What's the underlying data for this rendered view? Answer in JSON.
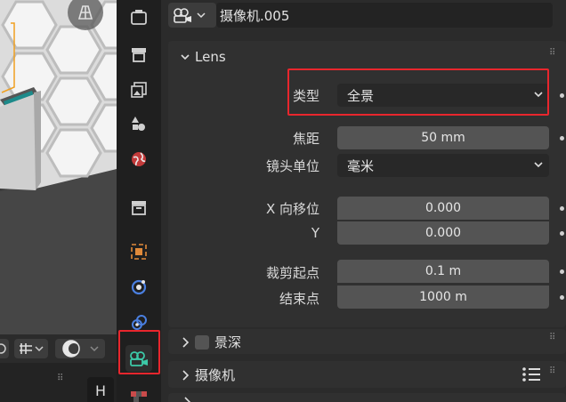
{
  "properties": {
    "object_name": "摄像机.005",
    "data_type_icon": "camera-data-icon"
  },
  "lens_panel": {
    "title": "Lens",
    "type_label": "类型",
    "type_value": "全景",
    "focal_label": "焦距",
    "focal_value": "50 mm",
    "unit_label": "镜头单位",
    "unit_value": "毫米",
    "shift_x_label": "X 向移位",
    "shift_x_value": "0.000",
    "shift_y_label": "Y",
    "shift_y_value": "0.000",
    "clip_start_label": "裁剪起点",
    "clip_start_value": "0.1 m",
    "clip_end_label": "结束点",
    "clip_end_value": "1000 m"
  },
  "dof_panel": {
    "title": "景深",
    "enabled": false
  },
  "camera_panel": {
    "title": "摄像机"
  },
  "viewport": {
    "vp_h_glyph": "H"
  },
  "tabs": [
    "tool-icon",
    "render-icon",
    "output-icon",
    "view-layer-icon",
    "scene-icon",
    "world-icon",
    "collection-icon",
    "object-icon",
    "physics-icon",
    "constraints-icon",
    "camera-data-icon",
    "texture-icon"
  ],
  "colors": {
    "accent_highlight": "#e8262d",
    "camera_icon": "#3cc9a8",
    "panel_bg": "#303030",
    "field_bg": "#545454"
  }
}
